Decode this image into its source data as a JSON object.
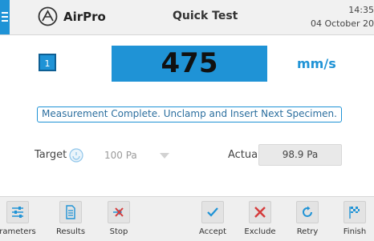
{
  "header": {
    "brand": "AirPro",
    "title": "Quick Test",
    "time": "14:35",
    "date": "04 October 20"
  },
  "test": {
    "number": "1",
    "value": "475",
    "unit": "mm/s",
    "status": "Measurement Complete. Unclamp and Insert Next Specimen."
  },
  "target": {
    "label": "Target",
    "value": "100 Pa",
    "icon": "gauge-icon"
  },
  "actual": {
    "label": "Actual",
    "value": "98.9 Pa"
  },
  "toolbar": {
    "parameters_label": "rameters",
    "results_label": "Results",
    "stop_label": "Stop",
    "accept_label": "Accept",
    "exclude_label": "Exclude",
    "retry_label": "Retry",
    "finish_label": "Finish"
  },
  "colors": {
    "accent": "#1f93d6",
    "exclude": "#d53b3b",
    "text": "#333333"
  }
}
